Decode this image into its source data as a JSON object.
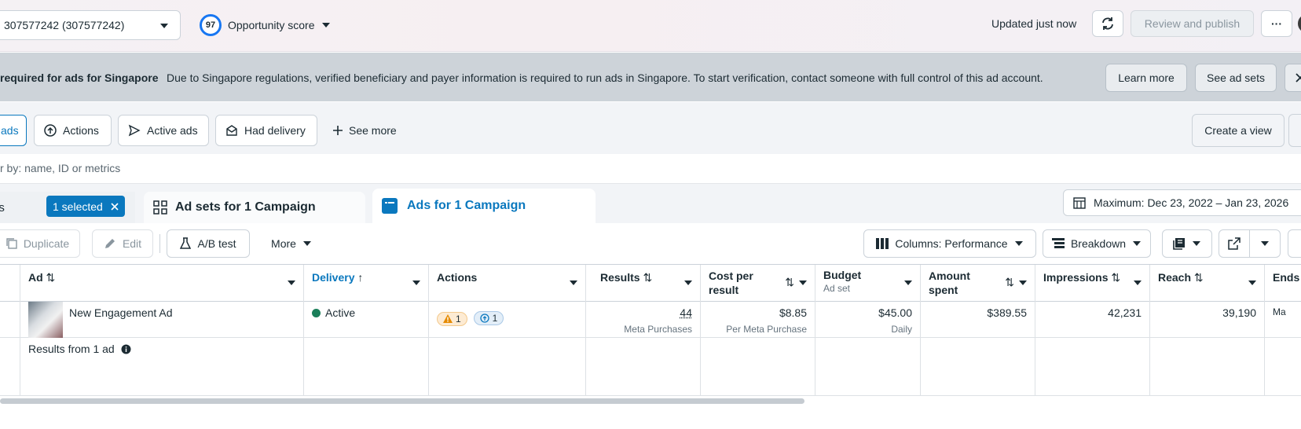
{
  "topbar": {
    "account_label": "307577242 (307577242)",
    "opportunity_score_value": "97",
    "opportunity_score_label": "Opportunity score",
    "updated_text": "Updated just now",
    "review_publish_label": "Review and publish",
    "more_label": "···"
  },
  "banner": {
    "title": "required for ads for Singapore",
    "text": "Due to Singapore regulations, verified beneficiary and payer information is required to run ads in Singapore. To start verification, contact someone with full control of this ad account.",
    "learn_more_label": "Learn more",
    "see_ad_sets_label": "See ad sets"
  },
  "filters": {
    "chips": [
      "ads",
      "Actions",
      "Active ads",
      "Had delivery"
    ],
    "see_more_label": "See more",
    "create_view_label": "Create a view"
  },
  "search": {
    "placeholder_text": "r by: name, ID or metrics"
  },
  "tabs": {
    "campaigns_label": "ns",
    "selected_badge": "1 selected",
    "ad_sets_label": "Ad sets for 1 Campaign",
    "ads_label": "Ads for 1 Campaign",
    "date_range": "Maximum: Dec 23, 2022 – Jan 23, 2026"
  },
  "toolbar": {
    "duplicate_label": "Duplicate",
    "edit_label": "Edit",
    "ab_test_label": "A/B test",
    "more_label": "More",
    "columns_label": "Columns: Performance",
    "breakdown_label": "Breakdown"
  },
  "table": {
    "headers": {
      "ad": "Ad",
      "delivery": "Delivery",
      "actions": "Actions",
      "results": "Results",
      "cost_per_result": "Cost per result",
      "budget": "Budget",
      "budget_sub": "Ad set",
      "amount_spent": "Amount spent",
      "impressions": "Impressions",
      "reach": "Reach",
      "ends": "Ends"
    },
    "row": {
      "ad_name": "New Engagement Ad",
      "delivery": "Active",
      "warning_count": "1",
      "info_count": "1",
      "results": "44",
      "results_sub": "Meta Purchases",
      "cost_per_result": "$8.85",
      "cost_per_result_sub": "Per Meta Purchase",
      "budget": "$45.00",
      "budget_sub": "Daily",
      "amount_spent": "$389.55",
      "impressions": "42,231",
      "reach": "39,190",
      "ends": "Ma"
    },
    "summary": {
      "label": "Results from 1 ad"
    }
  },
  "colors": {
    "accent": "#0a78be",
    "active_dot": "#1b7f5a",
    "warning": "#e58a00"
  }
}
